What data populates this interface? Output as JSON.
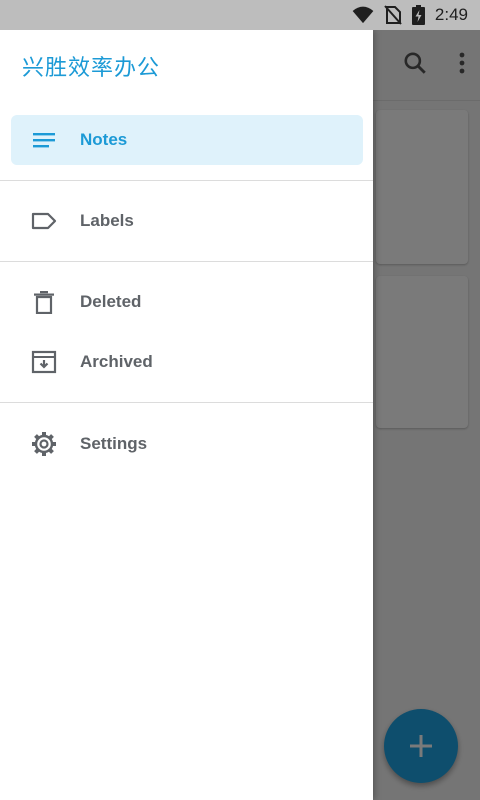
{
  "status_bar": {
    "time": "2:49"
  },
  "drawer": {
    "title": "兴胜效率办公",
    "items": [
      {
        "label": "Notes",
        "icon": "menu-lines-icon",
        "active": true
      },
      {
        "label": "Labels",
        "icon": "label-icon"
      },
      {
        "label": "Deleted",
        "icon": "trash-icon"
      },
      {
        "label": "Archived",
        "icon": "archive-icon"
      },
      {
        "label": "Settings",
        "icon": "gear-icon"
      }
    ]
  },
  "colors": {
    "accent": "#1c9ad6",
    "active_bg": "#dff2fb",
    "fab": "#1ea3e3"
  }
}
